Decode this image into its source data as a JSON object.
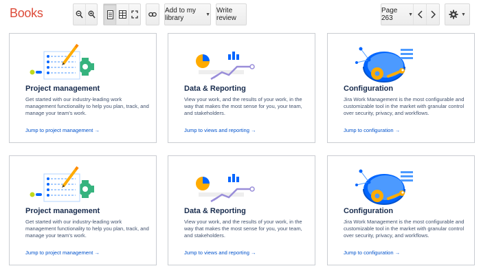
{
  "toolbar": {
    "brand": "Books",
    "add_library_label": "Add to my library",
    "write_review_label": "Write review",
    "page_label": "Page 263"
  },
  "icons": {
    "zoom_out": "zoom-out-icon",
    "zoom_in": "zoom-in-icon",
    "single_page": "single-page-view-icon",
    "two_page": "two-page-view-icon",
    "fullscreen": "fullscreen-icon",
    "link": "link-icon",
    "settings": "gear-icon"
  },
  "colors": {
    "brand": "#dd4b39",
    "title": "#172b4d",
    "body": "#42526e",
    "link": "#0052cc",
    "accent_yellow": "#ffab00",
    "accent_green": "#36b37e",
    "accent_blue": "#0065ff",
    "accent_purple": "#998dd9"
  },
  "cards": [
    {
      "title": "Project management",
      "desc": "Get started with our industry-leading work management functionality to help you plan, track, and manage your team's work.",
      "link": "Jump to project management",
      "arrow": "→"
    },
    {
      "title": "Data & Reporting",
      "desc": "View your work, and the results of your work, in the way that makes the most sense for you, your team, and stakeholders.",
      "link": "Jump to views and reporting",
      "arrow": "→"
    },
    {
      "title": "Configuration",
      "desc": "Jira Work Management is the most configurable and customizable tool in the market with granular control over security, privacy, and workflows.",
      "link": "Jump to configuration",
      "arrow": "→"
    },
    {
      "title": "Project management",
      "desc": "Get started with our industry-leading work management functionality to help you plan, track, and manage your team's work.",
      "link": "Jump to project management",
      "arrow": "→"
    },
    {
      "title": "Data & Reporting",
      "desc": "View your work, and the results of your work, in the way that makes the most sense for you, your team, and stakeholders.",
      "link": "Jump to views and reporting",
      "arrow": "→"
    },
    {
      "title": "Configuration",
      "desc": "Jira Work Management is the most configurable and customizable tool in the market with granular control over security, privacy, and workflows.",
      "link": "Jump to configuration",
      "arrow": "→"
    }
  ]
}
